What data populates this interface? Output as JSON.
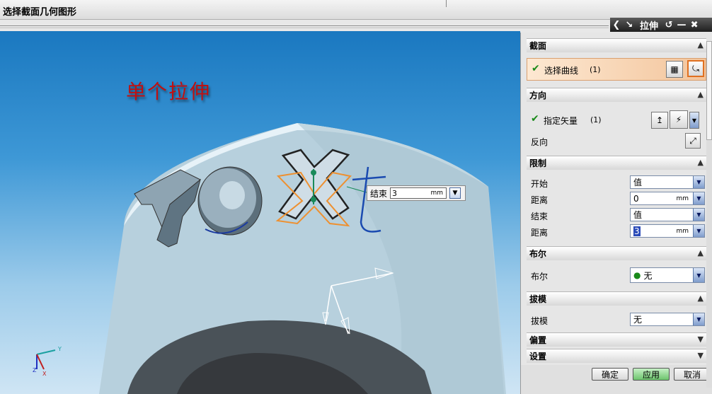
{
  "status": {
    "prompt": "选择截面几何图形"
  },
  "window": {
    "title": "拉伸",
    "back_icon": "back-arrow-icon",
    "pin_icon": "pin-icon",
    "reset_icon": "reset-icon",
    "minimize_icon": "minimize-icon",
    "close_icon": "close-icon"
  },
  "viewport": {
    "watermark": "单个拉伸",
    "dynamic_input": {
      "label": "结束",
      "value": "3",
      "unit": "mm"
    }
  },
  "dialog": {
    "section": {
      "header": "截面",
      "select_curve_label": "选择曲线",
      "select_curve_count": "(1)",
      "sketch_icon": "sketch-section-icon",
      "curve_icon": "curve-icon"
    },
    "direction": {
      "header": "方向",
      "vector_label": "指定矢量",
      "vector_count": "(1)",
      "reverse_label": "反向",
      "vector_dialog_icon": "vector-dialog-icon",
      "vector_dropdown_icon": "vector-dropdown-icon",
      "reverse_icon": "reverse-direction-icon"
    },
    "limits": {
      "header": "限制",
      "start_label": "开始",
      "start_value": "值",
      "start_dist_label": "距离",
      "start_dist_value": "0",
      "end_label": "结束",
      "end_value": "值",
      "end_dist_label": "距离",
      "end_dist_value": "3",
      "unit": "mm"
    },
    "boolean": {
      "header": "布尔",
      "label": "布尔",
      "value": "无"
    },
    "draft": {
      "header": "拔模",
      "label": "拔模",
      "value": "无"
    },
    "offset": {
      "header": "偏置"
    },
    "settings": {
      "header": "设置"
    },
    "buttons": {
      "ok": "确定",
      "apply": "应用",
      "cancel": "取消"
    }
  },
  "colors": {
    "accent": "#f3c59c",
    "apply": "#7fd07f",
    "viewport_top": "#1a78c0"
  }
}
